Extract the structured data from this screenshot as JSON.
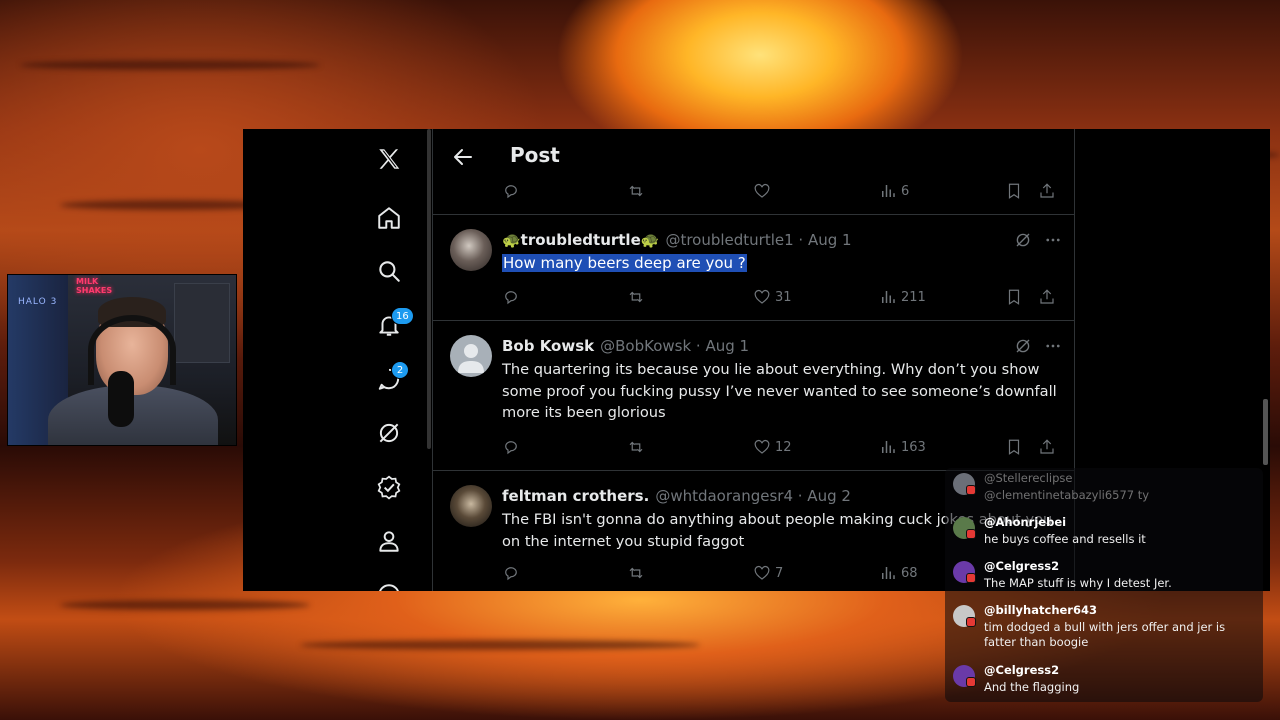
{
  "colors": {
    "accent": "#1d9bf0",
    "text": "#e7e9ea",
    "muted": "#71767b",
    "divider": "#2f3336",
    "highlight": "#1f4fb5"
  },
  "nav": {
    "items": [
      {
        "icon": "x-logo-icon"
      },
      {
        "icon": "home-icon"
      },
      {
        "icon": "search-icon"
      },
      {
        "icon": "bell-icon",
        "badge": "16"
      },
      {
        "icon": "messages-icon",
        "badge": "2"
      },
      {
        "icon": "grok-icon"
      },
      {
        "icon": "verified-icon"
      },
      {
        "icon": "profile-icon"
      }
    ]
  },
  "header": {
    "title": "Post"
  },
  "top_actions": {
    "views": "6"
  },
  "tweets": [
    {
      "name": "🐢troubledturtle🐢",
      "handle": "@troubledturtle1 · Aug 1",
      "body": "How many beers deep are you ?",
      "likes": "31",
      "views": "211"
    },
    {
      "name": "Bob Kowsk",
      "handle": "@BobKowsk · Aug 1",
      "body": "The quartering its because you lie about everything. Why don’t you show some proof you fucking pussy I’ve never wanted to see someone’s downfall more its been glorious",
      "likes": "12",
      "views": "163"
    },
    {
      "name": "feltman crothers.",
      "handle": "@whtdaorangesr4 · Aug 2",
      "body": "The FBI isn't gonna do anything about people making cuck jokes about you on the internet you stupid faggot",
      "likes": "7",
      "views": "68"
    }
  ],
  "chat": [
    {
      "name": "@Stellereclipse",
      "text": "@clementinetabazyli6577 ty",
      "faded": true
    },
    {
      "name": "@Ahonrjebei",
      "text": "he buys coffee and resells it"
    },
    {
      "name": "@Celgress2",
      "text": "The MAP stuff is why I detest Jer."
    },
    {
      "name": "@billyhatcher643",
      "text": "tim dodged a bull with jers offer and jer is fatter than boogie"
    },
    {
      "name": "@Celgress2",
      "text": "And the flagging"
    }
  ],
  "webcam": {
    "halo": "HALO 3",
    "neon": "MILK SHAKES"
  }
}
